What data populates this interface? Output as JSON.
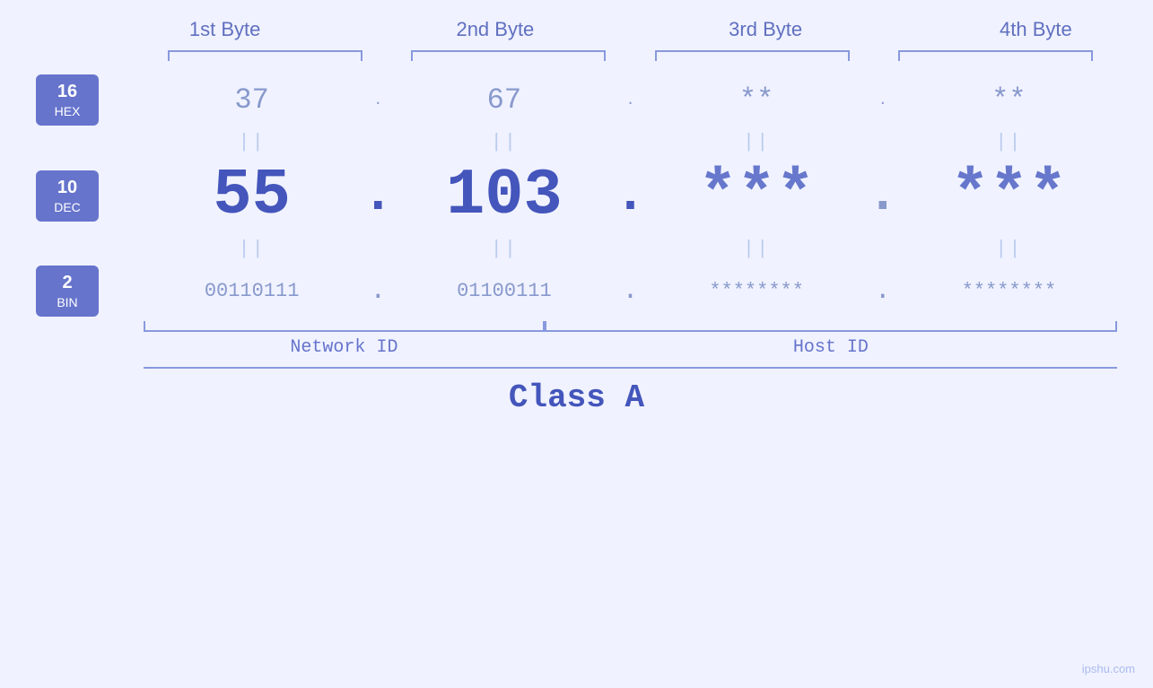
{
  "headers": {
    "byte1": "1st Byte",
    "byte2": "2nd Byte",
    "byte3": "3rd Byte",
    "byte4": "4th Byte"
  },
  "bases": {
    "hex": {
      "number": "16",
      "name": "HEX"
    },
    "dec": {
      "number": "10",
      "name": "DEC"
    },
    "bin": {
      "number": "2",
      "name": "BIN"
    }
  },
  "values": {
    "hex": {
      "b1": "37",
      "b2": "67",
      "b3": "**",
      "b4": "**",
      "sep": "."
    },
    "dec": {
      "b1": "55",
      "b2": "103",
      "b3": "***",
      "b4": "***",
      "sep": "."
    },
    "bin": {
      "b1": "00110111",
      "b2": "01100111",
      "b3": "********",
      "b4": "********",
      "sep": "."
    }
  },
  "labels": {
    "network_id": "Network ID",
    "host_id": "Host ID",
    "class": "Class A"
  },
  "watermark": "ipshu.com",
  "dbar": "||"
}
